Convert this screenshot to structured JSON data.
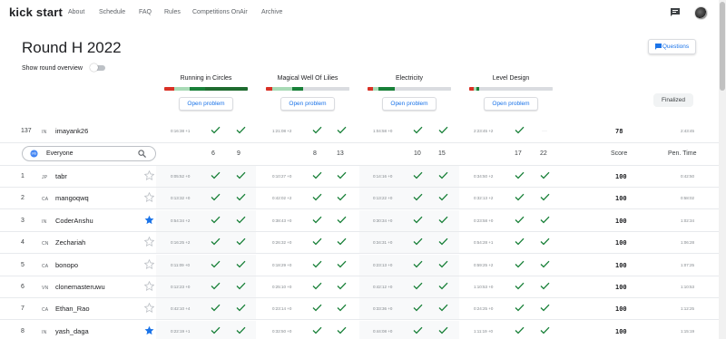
{
  "nav": {
    "brand": "kick start",
    "links": [
      "About",
      "Schedule",
      "FAQ",
      "Rules",
      "Competitions OnAir",
      "Archive"
    ]
  },
  "page": {
    "title": "Round H 2022",
    "overview_label": "Show round overview",
    "questions_label": "Questions",
    "finalized_label": "Finalized",
    "open_problem_label": "Open problem"
  },
  "colors": {
    "accent": "#1a73e8",
    "green": "#188038",
    "light_green": "#a8dab5",
    "red": "#d93025",
    "star": "#1a73e8"
  },
  "problems": [
    {
      "name": "Running in Circles",
      "bar": [
        [
          "#d93025",
          0.12
        ],
        [
          "#a8dab5",
          0.18
        ],
        [
          "#188038",
          0.19
        ],
        [
          "#1e6b2f",
          0.51
        ]
      ]
    },
    {
      "name": "Magical Well Of Lilies",
      "bar": [
        [
          "#d93025",
          0.08
        ],
        [
          "#a8dab5",
          0.24
        ],
        [
          "#188038",
          0.13
        ],
        [
          "#dadce0",
          0.55
        ]
      ]
    },
    {
      "name": "Electricity",
      "bar": [
        [
          "#d93025",
          0.06
        ],
        [
          "#a8dab5",
          0.07
        ],
        [
          "#188038",
          0.2
        ],
        [
          "#dadce0",
          0.67
        ]
      ]
    },
    {
      "name": "Level Design",
      "bar": [
        [
          "#d93025",
          0.05
        ],
        [
          "#a8dab5",
          0.04
        ],
        [
          "#188038",
          0.03
        ],
        [
          "#dadce0",
          0.88
        ]
      ]
    }
  ],
  "my_row": {
    "rank": "137",
    "country": "IN",
    "name": "imayank26",
    "times": [
      "0:16:38 +1",
      "1:21:08 +2",
      "1:04:58 +0",
      "2:23:45 +2"
    ],
    "checks": [
      [
        true,
        true
      ],
      [
        true,
        true
      ],
      [
        true,
        true
      ],
      [
        true,
        false
      ]
    ],
    "score": "78",
    "penalty": "2:43:45"
  },
  "filter": {
    "label": "Everyone"
  },
  "header": {
    "points": [
      "6",
      "9",
      "8",
      "13",
      "10",
      "15",
      "17",
      "22"
    ],
    "score_label": "Score",
    "penalty_label": "Pen. Time"
  },
  "rows": [
    {
      "rank": "1",
      "country": "JP",
      "name": "tabr",
      "starred": false,
      "times": [
        "0:05:52 +0",
        "0:10:27 +0",
        "0:14:16 +0",
        "0:34:50 +2"
      ],
      "score": "100",
      "penalty": "0:42:50"
    },
    {
      "rank": "2",
      "country": "CA",
      "name": "mangoqwq",
      "starred": false,
      "times": [
        "0:13:32 +0",
        "0:42:02 +2",
        "0:13:22 +0",
        "0:32:13 +2"
      ],
      "score": "100",
      "penalty": "0:58:02"
    },
    {
      "rank": "3",
      "country": "IN",
      "name": "CoderAnshu",
      "starred": true,
      "times": [
        "0:54:34 +2",
        "0:38:43 +0",
        "0:30:34 +0",
        "0:23:58 +0"
      ],
      "score": "100",
      "penalty": "1:02:34"
    },
    {
      "rank": "4",
      "country": "CN",
      "name": "Zechariah",
      "starred": false,
      "times": [
        "0:16:25 +2",
        "0:26:32 +0",
        "0:34:31 +0",
        "0:54:28 +1"
      ],
      "score": "100",
      "penalty": "1:06:28"
    },
    {
      "rank": "5",
      "country": "CA",
      "name": "bonopo",
      "starred": false,
      "times": [
        "0:11:09 +0",
        "0:18:29 +0",
        "0:23:13 +0",
        "0:59:25 +2"
      ],
      "score": "100",
      "penalty": "1:07:25"
    },
    {
      "rank": "6",
      "country": "VN",
      "name": "clonemasteruwu",
      "starred": false,
      "times": [
        "0:12:23 +0",
        "0:25:10 +0",
        "0:42:12 +0",
        "1:10:53 +0"
      ],
      "score": "100",
      "penalty": "1:10:53"
    },
    {
      "rank": "7",
      "country": "CA",
      "name": "Ethan_Rao",
      "starred": false,
      "times": [
        "0:42:10 +4",
        "0:23:14 +0",
        "0:33:36 +0",
        "0:24:25 +0"
      ],
      "score": "100",
      "penalty": "1:12:25"
    },
    {
      "rank": "8",
      "country": "IN",
      "name": "yash_daga",
      "starred": true,
      "times": [
        "0:22:19 +1",
        "0:32:50 +0",
        "0:44:08 +0",
        "1:11:19 +0"
      ],
      "score": "100",
      "penalty": "1:15:19"
    }
  ]
}
